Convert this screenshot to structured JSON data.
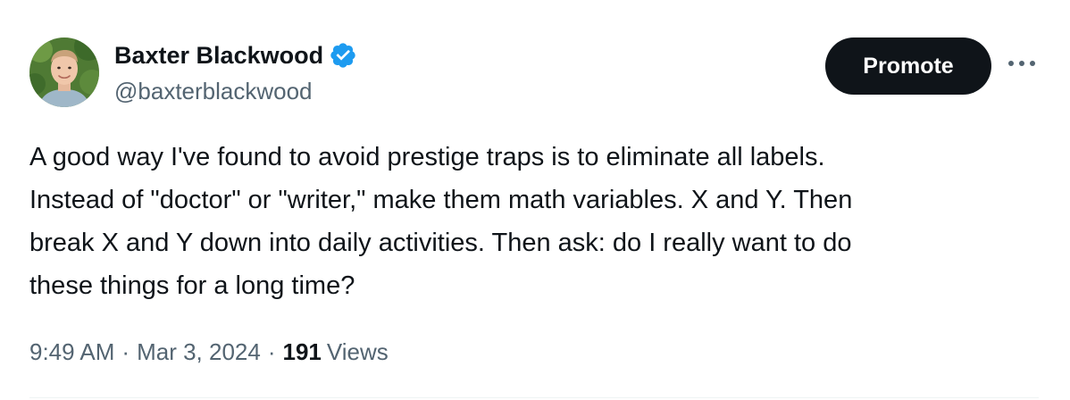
{
  "tweet": {
    "author": {
      "display_name": "Baxter Blackwood",
      "handle": "@baxterblackwood",
      "verified": true,
      "avatar_icon": "profile-photo"
    },
    "promote_label": "Promote",
    "more_icon": "more-horizontal-icon",
    "text": "A good way I've found to avoid prestige traps is to eliminate all labels.\nInstead of \"doctor\" or \"writer,\" make them math variables. X and Y. Then\nbreak X and Y down into daily activities. Then ask: do I really want to do\nthese things for a long time?",
    "time": "9:49 AM",
    "separator": "·",
    "date": "Mar 3, 2024",
    "views_count": "191",
    "views_label": "Views"
  },
  "colors": {
    "text_primary": "#0f1419",
    "text_secondary": "#536471",
    "verified_blue": "#1d9bf0",
    "button_bg": "#0f1419",
    "divider": "#eff3f4"
  }
}
